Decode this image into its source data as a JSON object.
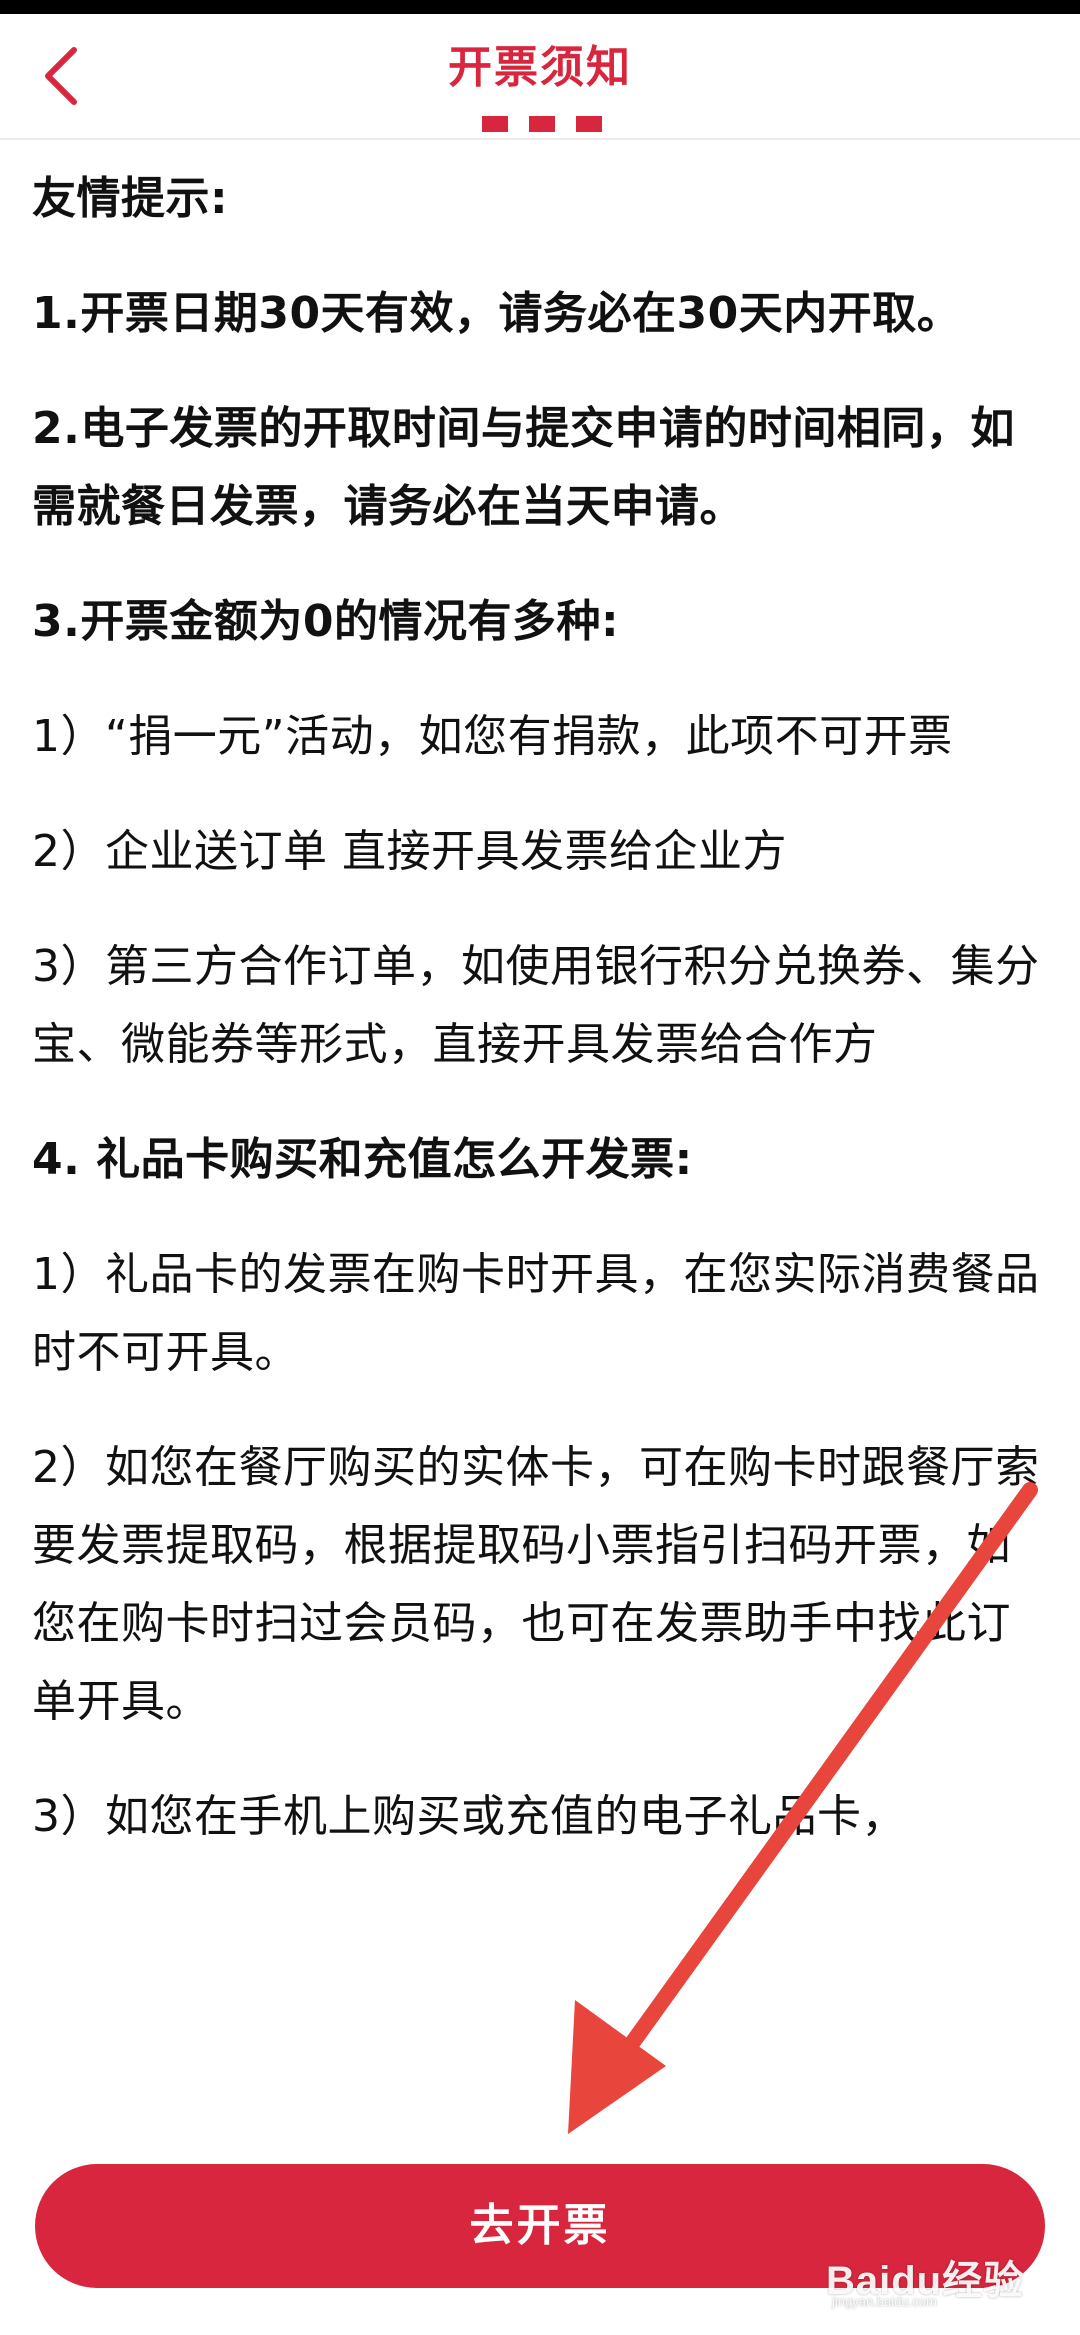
{
  "header": {
    "title": "开票须知"
  },
  "notice": {
    "paragraphs": [
      {
        "text": "友情提示:",
        "bold": true
      },
      {
        "text": "1.开票日期30天有效，请务必在30天内开取。",
        "bold": true
      },
      {
        "text": "2.电子发票的开取时间与提交申请的时间相同，如需就餐日发票，请务必在当天申请。",
        "bold": true
      },
      {
        "text": "3.开票金额为0的情况有多种:",
        "bold": true
      },
      {
        "text": "1）“捐一元”活动，如您有捐款，此项不可开票",
        "bold": false
      },
      {
        "text": "2）企业送订单  直接开具发票给企业方",
        "bold": false
      },
      {
        "text": "3）第三方合作订单，如使用银行积分兑换券、集分宝、微能券等形式，直接开具发票给合作方",
        "bold": false
      },
      {
        "text": "4. 礼品卡购买和充值怎么开发票:",
        "bold": true
      },
      {
        "text": "1）礼品卡的发票在购卡时开具，在您实际消费餐品时不可开具。",
        "bold": false
      },
      {
        "text": "2）如您在餐厅购买的实体卡，可在购卡时跟餐厅索要发票提取码，根据提取码小票指引扫码开票，如您在购卡时扫过会员码，也可在发票助手中找此订单开具。",
        "bold": false
      },
      {
        "text": "3）如您在手机上购买或充值的电子礼品卡，",
        "bold": false
      }
    ]
  },
  "footer": {
    "button_label": "去开票"
  },
  "watermark": {
    "brand": "Bai",
    "brand_paw": "du",
    "brand_cn": "经验",
    "domain": "jingyan.baidu.com"
  },
  "colors": {
    "accent": "#d7263d",
    "annotation_arrow": "#e8453c"
  },
  "icons": {
    "back": "chevron-left-icon"
  }
}
